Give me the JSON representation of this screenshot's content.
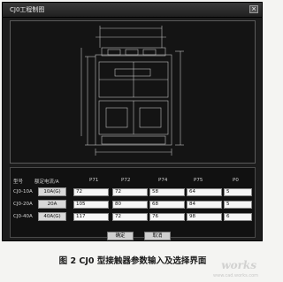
{
  "window": {
    "title": "CJ0工程制图"
  },
  "table": {
    "headers": [
      "型号",
      "额定电流/A",
      "P71",
      "P72",
      "P74",
      "P75",
      "P0"
    ],
    "rows": [
      {
        "model": "CJ0-10A",
        "button": "10A(G)",
        "values": [
          "72",
          "72",
          "58",
          "64",
          "5"
        ]
      },
      {
        "model": "CJ0-20A",
        "button": "20A",
        "values": [
          "105",
          "80",
          "68",
          "84",
          "5"
        ]
      },
      {
        "model": "CJ0-40A",
        "button": "40A(G)",
        "values": [
          "117",
          "72",
          "76",
          "98",
          "6"
        ]
      }
    ]
  },
  "actions": {
    "ok_label": "确定",
    "cancel_label": "取消"
  },
  "caption": "图 2   CJ0 型接触器参数输入及选择界面",
  "watermark": {
    "brand": "works",
    "sub": "www.cad.works.com"
  }
}
